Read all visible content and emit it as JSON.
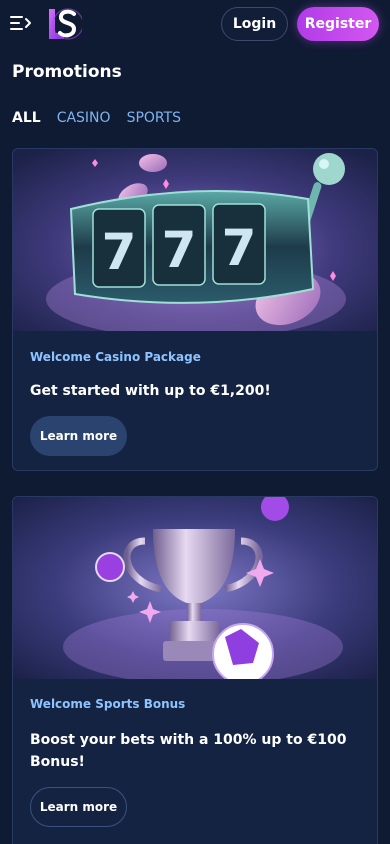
{
  "header": {
    "menu_icon": "menu-collapse-icon",
    "logo": "ls-logo",
    "login_label": "Login",
    "register_label": "Register"
  },
  "page": {
    "title": "Promotions"
  },
  "tabs": [
    {
      "label": "ALL",
      "active": true
    },
    {
      "label": "CASINO",
      "active": false
    },
    {
      "label": "SPORTS",
      "active": false
    }
  ],
  "promotions": [
    {
      "category": "Welcome Casino Package",
      "headline": "Get started with up to €1,200!",
      "button_label": "Learn more",
      "image": "slot-machine-777-illustration"
    },
    {
      "category": "Welcome Sports Bonus",
      "headline": "Boost your bets with a 100% up to €100 Bonus!",
      "button_label": "Learn more",
      "image": "trophy-football-illustration"
    }
  ],
  "colors": {
    "background": "#0f1a33",
    "card": "#142342",
    "accent": "#c04be8",
    "tab_inactive": "#7fb4ef",
    "category_text": "#8dc3ff"
  }
}
